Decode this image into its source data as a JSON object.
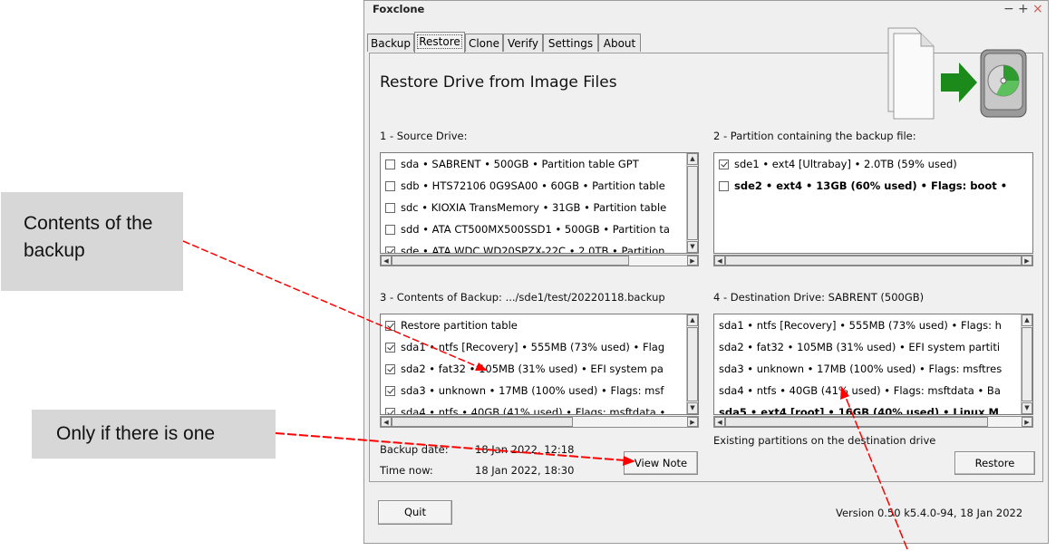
{
  "callouts": {
    "contents": "Contents of the backup",
    "note": "Only if there is one"
  },
  "window": {
    "title": "Foxclone",
    "controls": {
      "minimize": "−",
      "maximize": "+",
      "close": "×"
    },
    "colors": {
      "close": "#d9534f",
      "arrow": "#ff0000",
      "green_arrow": "#1b8a1b"
    }
  },
  "tabs": [
    {
      "label": "Backup"
    },
    {
      "label": "Restore",
      "active": true
    },
    {
      "label": "Clone"
    },
    {
      "label": "Verify"
    },
    {
      "label": "Settings"
    },
    {
      "label": "About"
    }
  ],
  "heading": "Restore Drive from Image Files",
  "source": {
    "label": "1 - Source Drive:",
    "items": [
      {
        "text": "sda • SABRENT • 500GB • Partition table GPT",
        "checked": false
      },
      {
        "text": "sdb • HTS72106 0G9SA00 • 60GB • Partition table",
        "checked": false
      },
      {
        "text": "sdc • KIOXIA TransMemory • 31GB • Partition table",
        "checked": false
      },
      {
        "text": "sdd • ATA CT500MX500SSD1 • 500GB • Partition ta",
        "checked": false
      },
      {
        "text": "sde • ATA WDC WD20SPZX-22C • 2.0TB • Partition",
        "checked": true
      }
    ]
  },
  "partition": {
    "label": "2 - Partition containing the backup file:",
    "items": [
      {
        "text": "sde1 • ext4 [Ultrabay] • 2.0TB (59% used)",
        "checked": true,
        "bold": false
      },
      {
        "text": "sde2 • ext4 • 13GB (60% used) • Flags: boot •",
        "checked": false,
        "bold": true
      }
    ]
  },
  "contents": {
    "label": "3 - Contents of Backup: .../sde1/test/20220118.backup",
    "items": [
      {
        "text": "Restore partition table",
        "checked": true
      },
      {
        "text": "sda1 • ntfs [Recovery] • 555MB (73% used) • Flag",
        "checked": true
      },
      {
        "text": "sda2 • fat32 • 105MB (31% used) • EFI system pa",
        "checked": true
      },
      {
        "text": "sda3 • unknown • 17MB (100% used) • Flags: msf",
        "checked": true
      },
      {
        "text": "sda4 • ntfs • 40GB (41% used) • Flags: msftdata •",
        "checked": true
      }
    ]
  },
  "destination": {
    "label": "4 - Destination Drive: SABRENT (500GB)",
    "items": [
      {
        "text": "sda1 • ntfs [Recovery] • 555MB (73% used) • Flags: h",
        "bold": false
      },
      {
        "text": "sda2 • fat32 • 105MB (31% used) • EFI system partiti",
        "bold": false
      },
      {
        "text": "sda3 • unknown • 17MB (100% used) • Flags: msftres",
        "bold": false
      },
      {
        "text": "sda4 • ntfs • 40GB (41% used) • Flags: msftdata • Ba",
        "bold": false
      },
      {
        "text": "sda5 • ext4 [root] • 16GB (40% used) • Linux M",
        "bold": true
      }
    ],
    "note": "Existing partitions on the destination drive"
  },
  "info": {
    "backup_date_label": "Backup date:",
    "backup_date": "18 Jan 2022, 12:18",
    "time_now_label": "Time now:",
    "time_now": "18 Jan 2022, 18:30"
  },
  "buttons": {
    "view_note": "View Note",
    "restore": "Restore",
    "quit": "Quit"
  },
  "version": "Version 0.50 k5.4.0-94, 18 Jan 2022"
}
